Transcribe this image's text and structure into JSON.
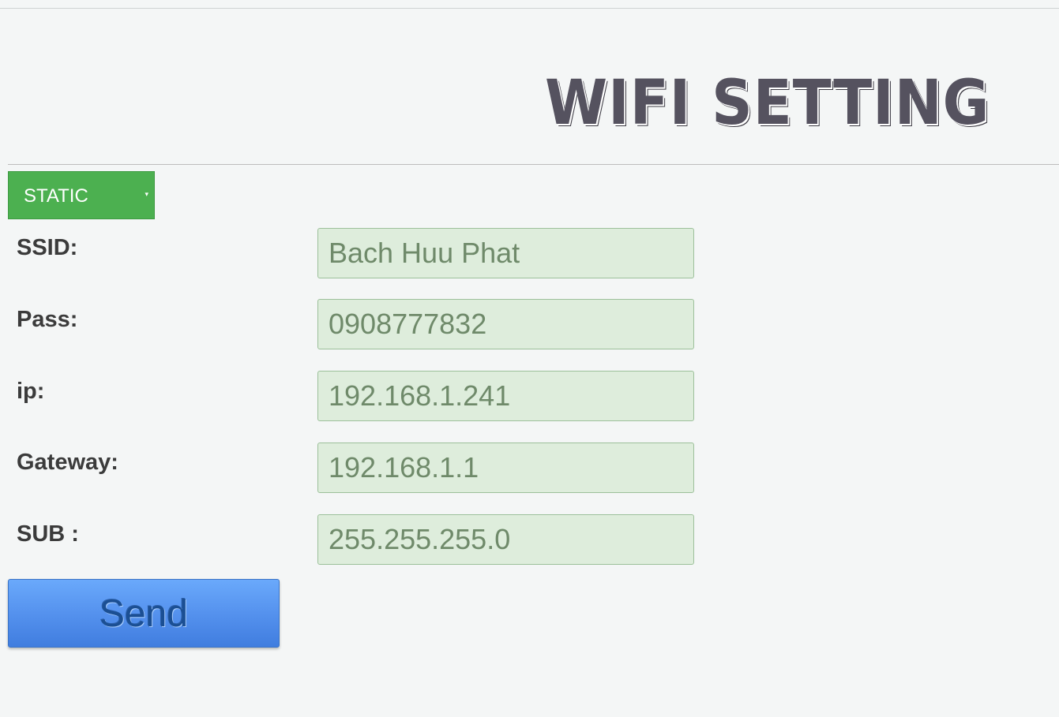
{
  "header": {
    "title": "WIFI SETTING"
  },
  "mode": {
    "selected": "STATIC",
    "arrow": "▾"
  },
  "fields": [
    {
      "label": "SSID:",
      "value": "Bach Huu Phat"
    },
    {
      "label": "Pass:",
      "value": "0908777832"
    },
    {
      "label": "ip:",
      "value": "192.168.1.241"
    },
    {
      "label": "Gateway:",
      "value": "192.168.1.1"
    },
    {
      "label": "SUB :",
      "value": "255.255.255.0"
    }
  ],
  "actions": {
    "send_label": "Send"
  },
  "colors": {
    "page_background": "#f4f6f6",
    "select_background": "#4cb050",
    "input_background": "#deeddc",
    "input_text": "#6f8a6a",
    "button_blue": "#5592ee",
    "title_text": "#55525f"
  }
}
